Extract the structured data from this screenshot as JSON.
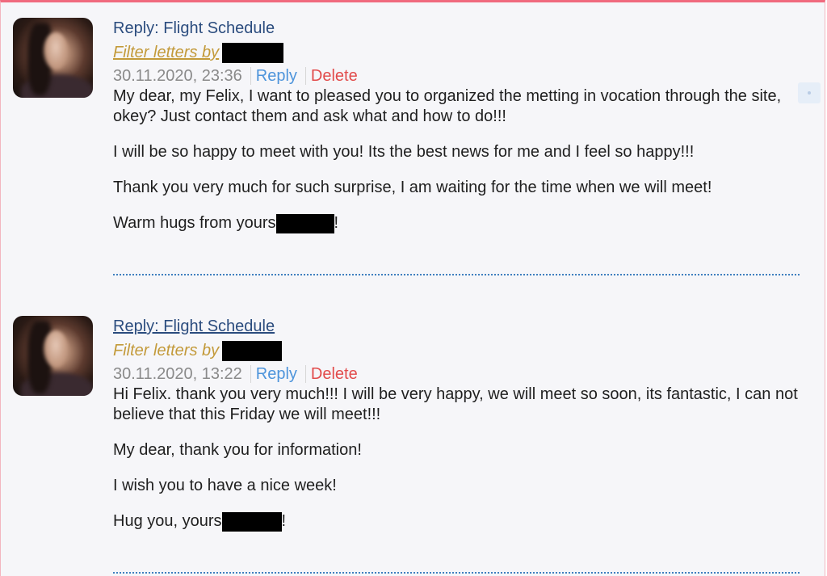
{
  "messages": [
    {
      "subject": "Reply: Flight Schedule",
      "filter_label": "Filter letters by",
      "datetime": "30.11.2020, 23:36",
      "reply_label": "Reply",
      "delete_label": "Delete",
      "paragraphs": [
        "My dear, my Felix, I want to pleased you to organized the metting in vocation through the site, okey? Just contact them and ask what and how to do!!!",
        "I will be so happy to meet with you! Its the best news for me and I feel so happy!!!",
        "Thank you very much for such surprise, I am waiting for the time when we will meet!"
      ],
      "signoff_prefix": "Warm hugs from yours",
      "signoff_suffix": "!"
    },
    {
      "subject": "Reply: Flight Schedule",
      "filter_label": "Filter letters by",
      "datetime": "30.11.2020, 13:22",
      "reply_label": "Reply",
      "delete_label": "Delete",
      "paragraphs": [
        "Hi Felix. thank you very much!!! I will be very happy, we will meet so soon, its fantastic, I can not believe that this Friday we will meet!!!",
        "My dear, thank you for information!",
        "I wish you to have a nice week!"
      ],
      "signoff_prefix": "Hug you, yours",
      "signoff_suffix": "!"
    }
  ],
  "colors": {
    "subject": "#2b4c7e",
    "filter": "#c39a3a",
    "reply": "#4d94db",
    "delete": "#e24b4b",
    "divider": "#3f7fbf",
    "frame_accent": "#f06a7e"
  }
}
